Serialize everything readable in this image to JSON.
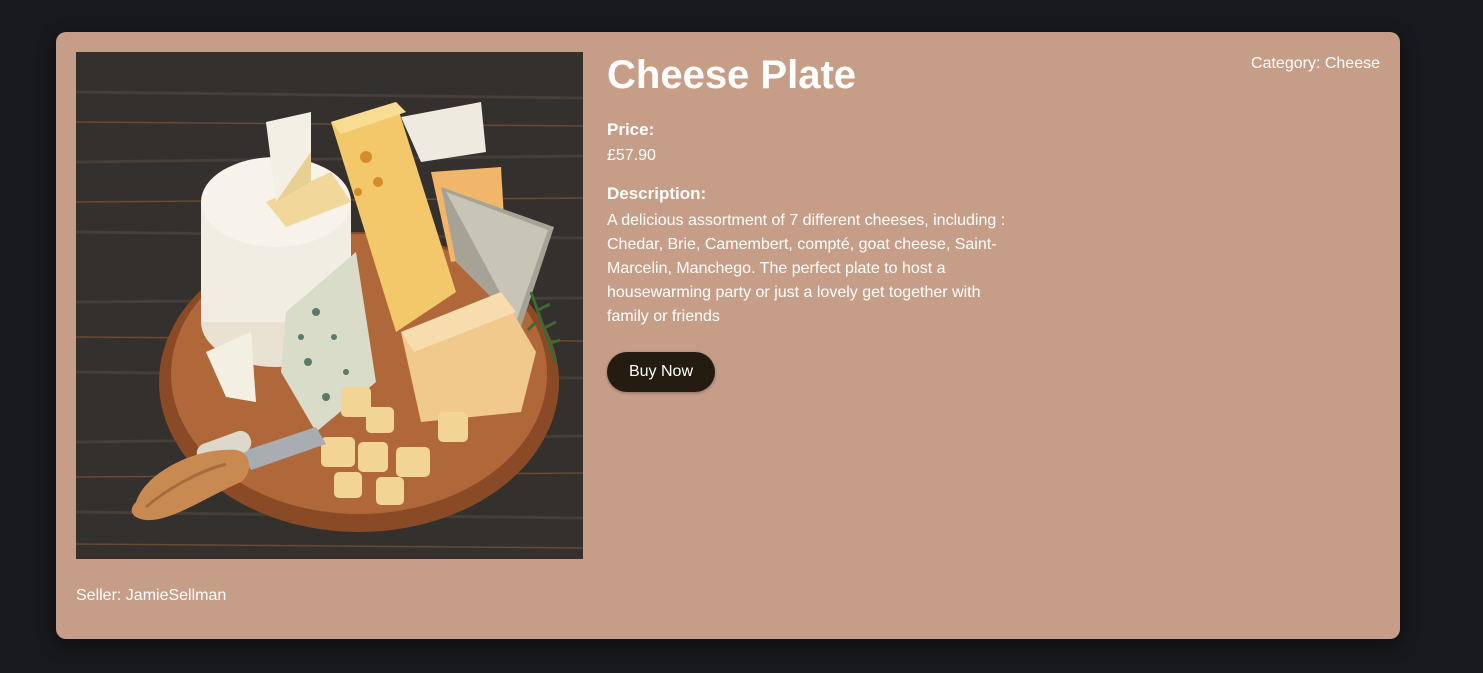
{
  "product": {
    "title": "Cheese Plate",
    "category": "Category: Cheese",
    "price_label": "Price:",
    "price": "£57.90",
    "description_label": "Description:",
    "description": "A delicious assortment of 7 different cheeses, including : Chedar, Brie, Camembert, compté, goat cheese, Saint-Marcelin, Manchego. The perfect plate to host a housewarming party or just a lovely get together with family or friends",
    "buy_label": "Buy Now",
    "seller": "Seller: JamieSellman",
    "image_icon": "cheese-plate-photo"
  },
  "colors": {
    "page_background": "#18191c",
    "card_background": "#c69e88",
    "button_background": "#241c10",
    "text": "#ffffff"
  }
}
